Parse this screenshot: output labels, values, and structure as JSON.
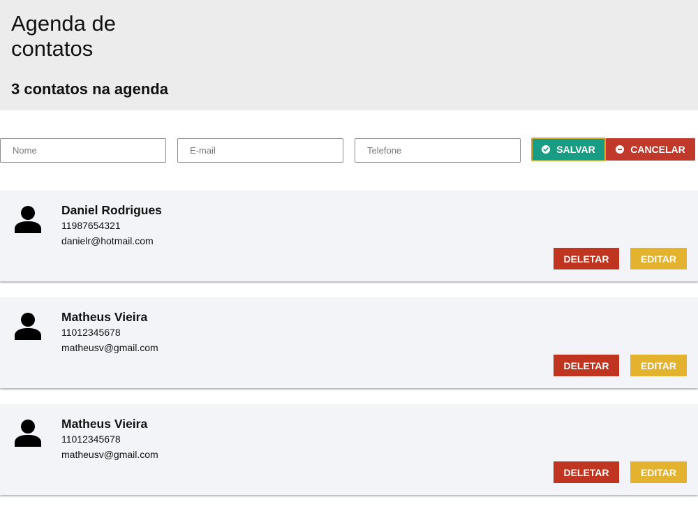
{
  "header": {
    "title": "Agenda de contatos",
    "count_text": "3 contatos na agenda"
  },
  "form": {
    "name_placeholder": "Nome",
    "email_placeholder": "E-mail",
    "phone_placeholder": "Telefone",
    "save_label": "SALVAR",
    "cancel_label": "CANCELAR",
    "save_icon": "check-circle-icon",
    "cancel_icon": "minus-circle-icon"
  },
  "contacts": [
    {
      "name": "Daniel Rodrigues",
      "phone": "11987654321",
      "email": "danielr@hotmail.com",
      "delete_label": "DELETAR",
      "edit_label": "EDITAR"
    },
    {
      "name": "Matheus Vieira",
      "phone": "11012345678",
      "email": "matheusv@gmail.com",
      "delete_label": "DELETAR",
      "edit_label": "EDITAR"
    },
    {
      "name": "Matheus Vieira",
      "phone": "11012345678",
      "email": "matheusv@gmail.com",
      "delete_label": "DELETAR",
      "edit_label": "EDITAR"
    }
  ],
  "colors": {
    "header_bg": "#ececec",
    "card_bg": "#f3f4f7",
    "save": "#189c83",
    "save_border": "#d4aa2e",
    "cancel": "#c0392b",
    "delete": "#c0351f",
    "edit": "#e3b22f"
  }
}
